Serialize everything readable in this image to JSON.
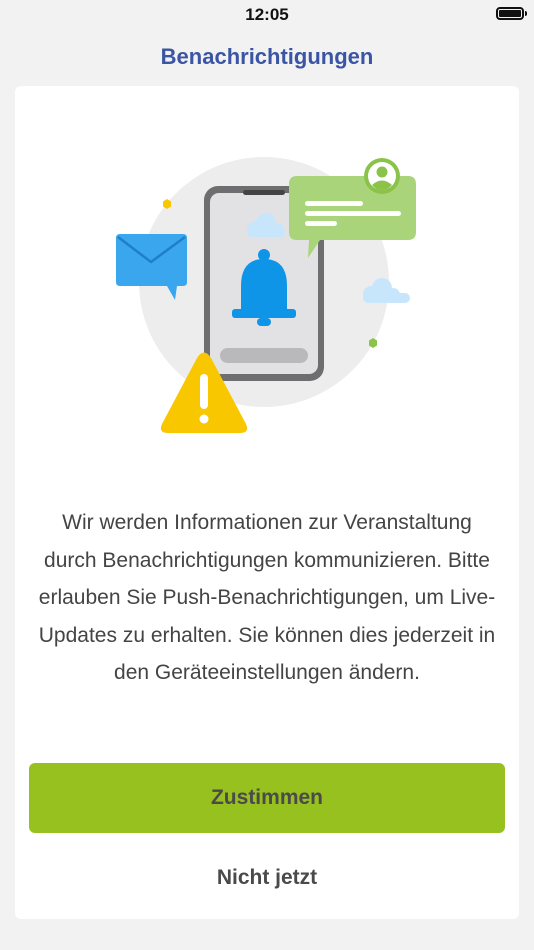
{
  "status_bar": {
    "time": "12:05"
  },
  "header": {
    "title": "Benachrichtigungen"
  },
  "main": {
    "description": "Wir werden Informationen zur Veranstaltung durch Benachrichtigungen kommunizieren. Bitte erlauben Sie Push-Benachrichtigungen, um Live-Updates zu erhalten. Sie können dies jederzeit in den Geräteeinstellungen ändern.",
    "agree_label": "Zustimmen",
    "later_label": "Nicht jetzt"
  },
  "colors": {
    "title": "#3b55a4",
    "primary_button": "#97c11f",
    "bell": "#0f95e8",
    "warning": "#f8c700",
    "chat_bubble": "#a9d47a",
    "envelope": "#3aa6ee"
  }
}
